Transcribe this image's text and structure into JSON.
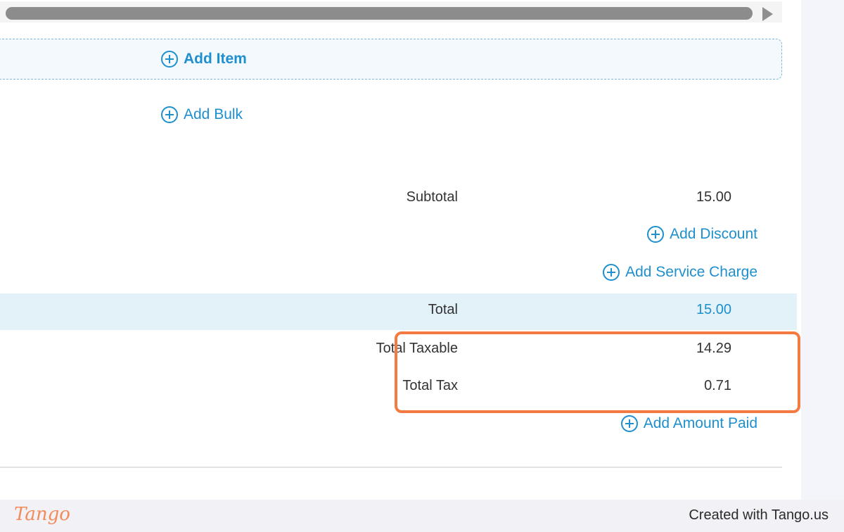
{
  "actions": {
    "add_item": "Add Item",
    "add_bulk": "Add Bulk",
    "add_discount": "Add Discount",
    "add_service_charge": "Add Service Charge",
    "add_amount_paid": "Add Amount Paid"
  },
  "totals": {
    "subtotal_label": "Subtotal",
    "subtotal_value": "15.00",
    "total_label": "Total",
    "total_value": "15.00",
    "total_taxable_label": "Total Taxable",
    "total_taxable_value": "14.29",
    "total_tax_label": "Total Tax",
    "total_tax_value": "0.71"
  },
  "footer": {
    "logo": "Tango",
    "credit": "Created with Tango.us"
  },
  "colors": {
    "link": "#1e8fcf",
    "highlight": "#f47a42",
    "total_band": "#e3f1f9"
  }
}
